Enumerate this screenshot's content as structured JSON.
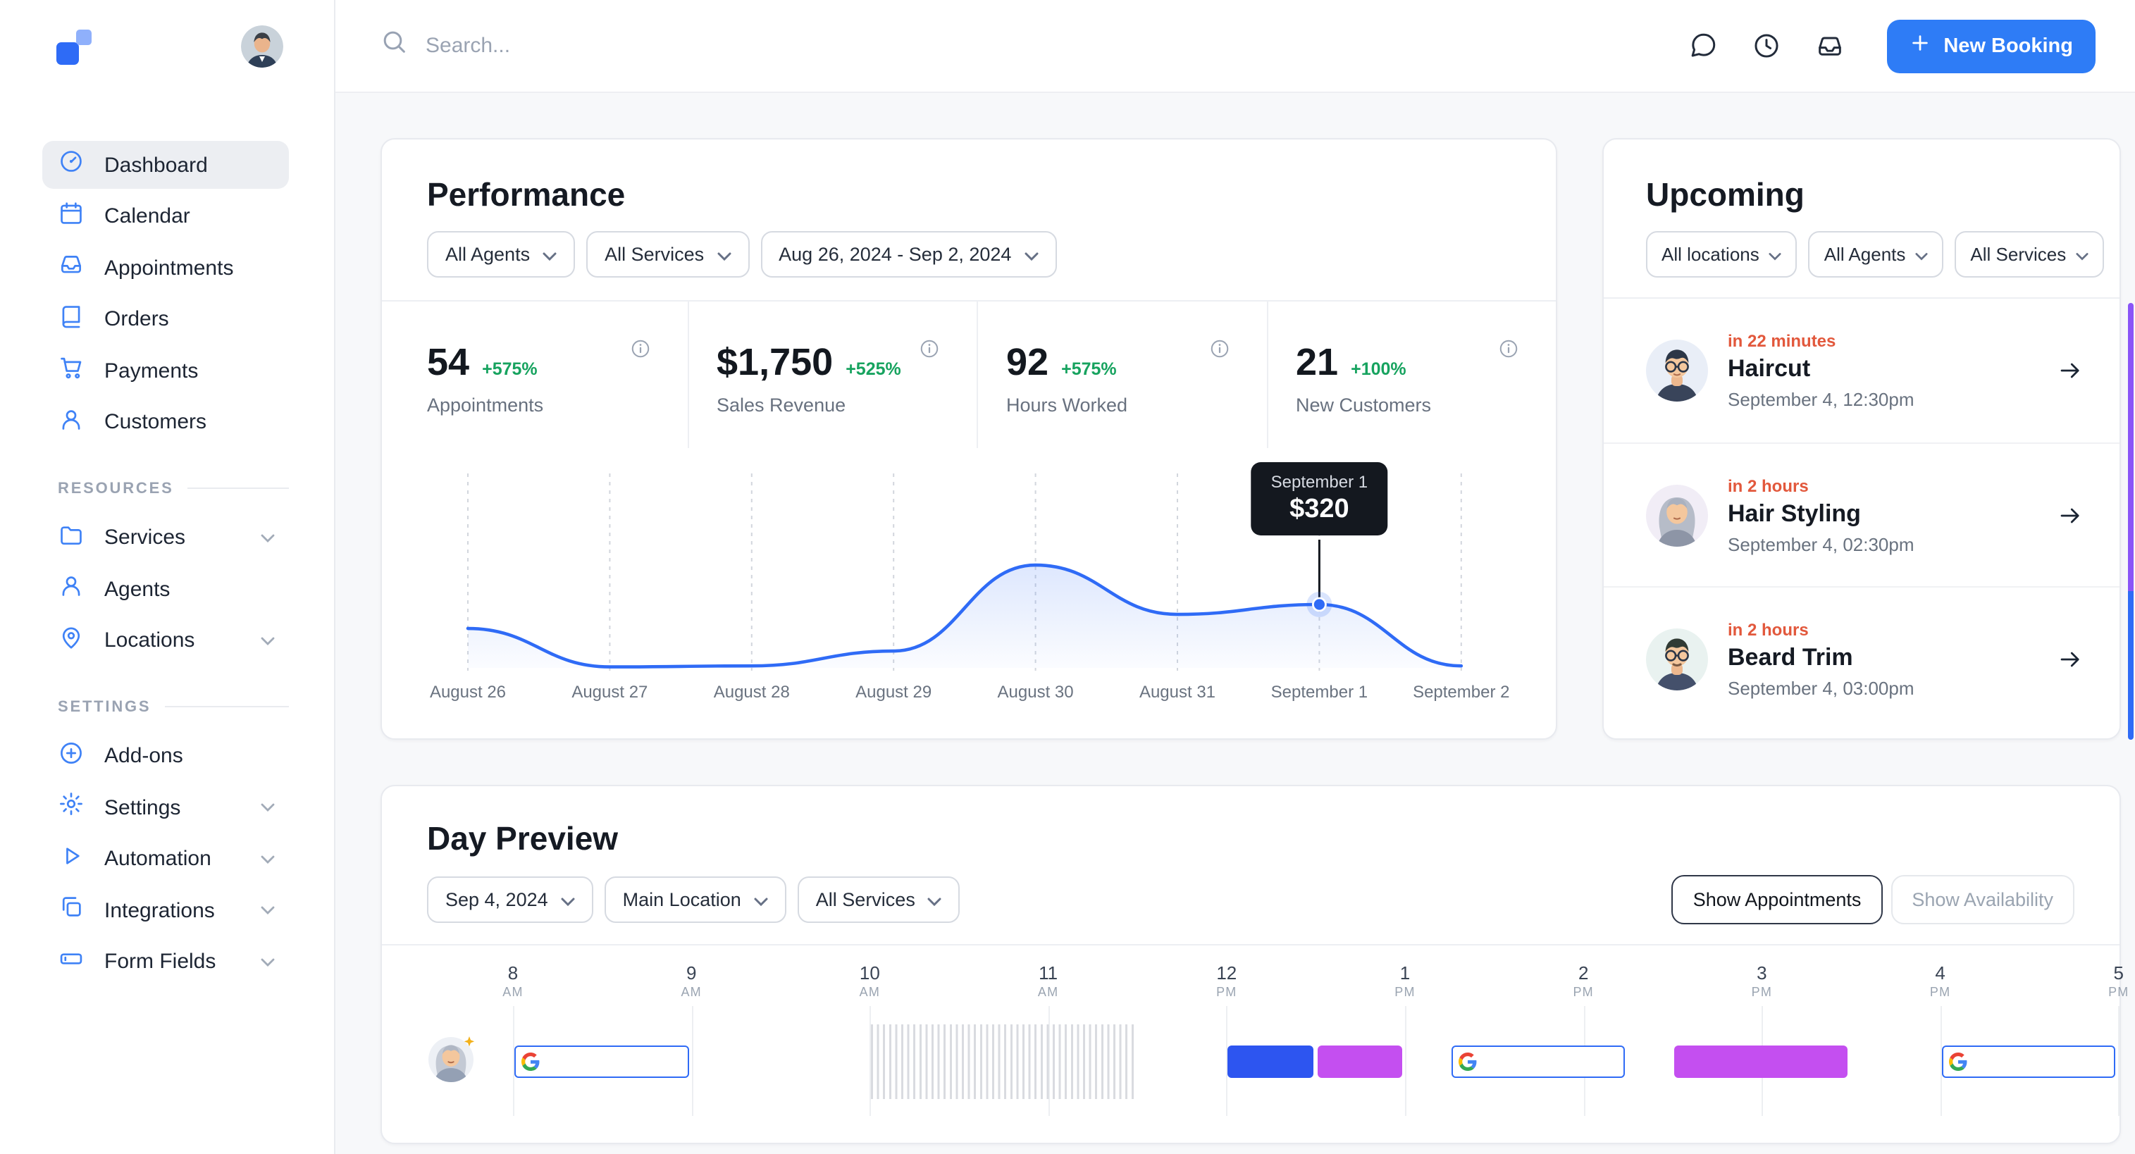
{
  "topbar": {
    "search_placeholder": "Search...",
    "new_booking": "New Booking"
  },
  "sidebar": {
    "main": [
      {
        "label": "Dashboard"
      },
      {
        "label": "Calendar"
      },
      {
        "label": "Appointments"
      },
      {
        "label": "Orders"
      },
      {
        "label": "Payments"
      },
      {
        "label": "Customers"
      }
    ],
    "resources_title": "RESOURCES",
    "resources": [
      {
        "label": "Services"
      },
      {
        "label": "Agents"
      },
      {
        "label": "Locations"
      }
    ],
    "settings_title": "SETTINGS",
    "settings": [
      {
        "label": "Add-ons"
      },
      {
        "label": "Settings"
      },
      {
        "label": "Automation"
      },
      {
        "label": "Integrations"
      },
      {
        "label": "Form Fields"
      }
    ]
  },
  "performance": {
    "title": "Performance",
    "filters": {
      "agents": "All Agents",
      "services": "All Services",
      "range": "Aug 26, 2024 - Sep 2, 2024"
    },
    "stats": [
      {
        "value": "54",
        "delta": "+575%",
        "label": "Appointments"
      },
      {
        "value": "$1,750",
        "delta": "+525%",
        "label": "Sales Revenue"
      },
      {
        "value": "92",
        "delta": "+575%",
        "label": "Hours Worked"
      },
      {
        "value": "21",
        "delta": "+100%",
        "label": "New Customers"
      }
    ]
  },
  "chart_data": {
    "type": "line",
    "title": "Performance",
    "x": [
      "August 26",
      "August 27",
      "August 28",
      "August 29",
      "August 30",
      "August 31",
      "September 1",
      "September 2"
    ],
    "values": [
      199,
      5,
      10,
      85,
      519,
      270,
      320,
      10
    ],
    "ylim": [
      0,
      560
    ],
    "grid": "vertical-dashed",
    "line_color": "#2f6bf6",
    "tooltip": {
      "index": 6,
      "label": "September 1",
      "value": "$320"
    }
  },
  "upcoming": {
    "title": "Upcoming",
    "filters": {
      "locations": "All locations",
      "agents": "All Agents",
      "services": "All Services"
    },
    "items": [
      {
        "eta": "in 22 minutes",
        "service": "Haircut",
        "datetime": "September 4, 12:30pm"
      },
      {
        "eta": "in 2 hours",
        "service": "Hair Styling",
        "datetime": "September 4, 02:30pm"
      },
      {
        "eta": "in 2 hours",
        "service": "Beard Trim",
        "datetime": "September 4, 03:00pm"
      }
    ]
  },
  "day_preview": {
    "title": "Day Preview",
    "filters": {
      "date": "Sep 4, 2024",
      "location": "Main Location",
      "services": "All Services"
    },
    "toggles": {
      "appointments": "Show Appointments",
      "availability": "Show Availability",
      "active": "appointments"
    },
    "hours": [
      {
        "label": "8",
        "meridiem": "AM"
      },
      {
        "label": "9",
        "meridiem": "AM"
      },
      {
        "label": "10",
        "meridiem": "AM"
      },
      {
        "label": "11",
        "meridiem": "AM"
      },
      {
        "label": "12",
        "meridiem": "PM"
      },
      {
        "label": "1",
        "meridiem": "PM"
      },
      {
        "label": "2",
        "meridiem": "PM"
      },
      {
        "label": "3",
        "meridiem": "PM"
      },
      {
        "label": "4",
        "meridiem": "PM"
      },
      {
        "label": "5",
        "meridiem": "PM"
      }
    ],
    "events": [
      {
        "type": "google",
        "start": 8,
        "end": 9
      },
      {
        "type": "blocked",
        "start": 10,
        "end": 11.5
      },
      {
        "type": "blue",
        "start": 12,
        "end": 12.5
      },
      {
        "type": "purple",
        "start": 12.5,
        "end": 13
      },
      {
        "type": "google",
        "start": 13.25,
        "end": 14.25
      },
      {
        "type": "purple",
        "start": 14.5,
        "end": 15.5
      },
      {
        "type": "google",
        "start": 16,
        "end": 17
      }
    ]
  },
  "colors": {
    "accent": "#2e7cf6",
    "icon_blue": "#3f82f6",
    "delta_green": "#17a35f",
    "eta_red": "#e2583c",
    "event_blue": "#2d55f0",
    "event_purple": "#c44ff0",
    "chart_line": "#2f6bf6",
    "scrollbar_purple": "#8a55f7",
    "scrollbar_blue": "#2f6bf6"
  }
}
